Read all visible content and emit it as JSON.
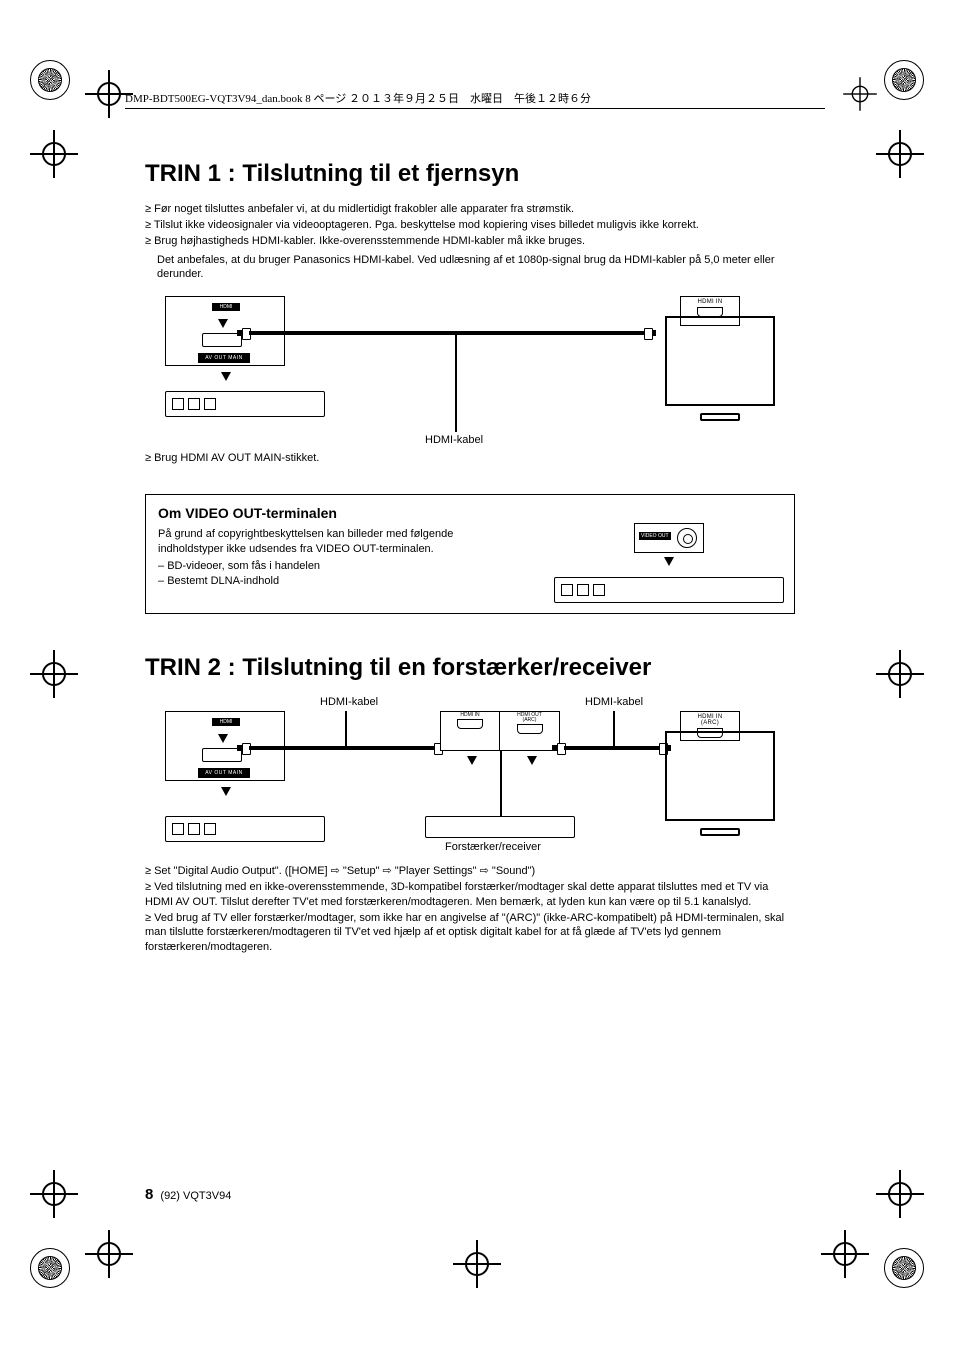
{
  "header": "DMP-BDT500EG-VQT3V94_dan.book  8 ページ  ２０１３年９月２５日　水曜日　午後１２時６分",
  "trin1": {
    "title": "TRIN 1 :   Tilslutning til et fjernsyn",
    "bullets": [
      "Før noget tilsluttes anbefaler vi, at du midlertidigt frakobler alle apparater fra strømstik.",
      "Tilslut ikke videosignaler via videooptageren. Pga. beskyttelse mod kopiering vises billedet muligvis ikke korrekt.",
      "Brug højhastigheds HDMI-kabler. Ikke-overensstemmende HDMI-kabler må ikke bruges."
    ],
    "note": "Det anbefales, at du bruger Panasonics HDMI-kabel. Ved udlæsning af et 1080p-signal brug da HDMI-kabler på 5,0 meter eller derunder.",
    "hdmi_logo": "HDMI",
    "avout": "AV OUT   MAIN",
    "hdmi_in": "HDMI IN",
    "cable_label": "HDMI-kabel",
    "post_bullet": "Brug HDMI AV OUT MAIN-stikket."
  },
  "videoout": {
    "title": "Om VIDEO OUT-terminalen",
    "body": "På grund af copyrightbeskyttelsen kan billeder med følgende indholdstyper ikke udsendes fra VIDEO OUT-terminalen.",
    "items": [
      "BD-videoer, som fås i handelen",
      "Bestemt DLNA-indhold"
    ],
    "label": "VIDEO OUT"
  },
  "trin2": {
    "title": "TRIN 2 :   Tilslutning til en forstærker/receiver",
    "cable_label": "HDMI-kabel",
    "hdmi_in": "HDMI IN",
    "hdmi_out_arc": "HDMI OUT\n(ARC)",
    "hdmi_in_arc": "HDMI IN\n(ARC)",
    "amp_label": "Forstærker/receiver",
    "bullets": [
      "Set \"Digital Audio Output\". ([HOME] ⇨ \"Setup\" ⇨ \"Player Settings\" ⇨ \"Sound\")",
      "Ved tilslutning med en ikke-overensstemmende, 3D-kompatibel forstærker/modtager skal dette apparat tilsluttes med et TV via HDMI AV OUT. Tilslut derefter TV'et med forstærkeren/modtageren. Men bemærk, at lyden kun kan være op til 5.1 kanalslyd.",
      "Ved brug af TV eller forstærker/modtager, som ikke har en angivelse af \"(ARC)\" (ikke-ARC-kompatibelt) på HDMI-terminalen, skal man tilslutte forstærkeren/modtageren til TV'et ved hjælp af et optisk digitalt kabel for at få glæde af TV'ets lyd gennem forstærkeren/modtageren."
    ]
  },
  "footer": {
    "page": "8",
    "aux": "(92)  VQT3V94"
  }
}
